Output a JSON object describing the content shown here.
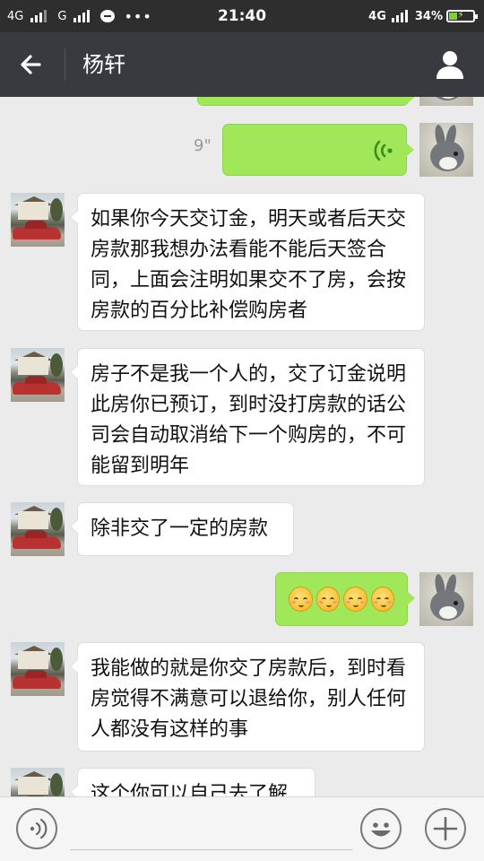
{
  "status_bar": {
    "left_network_1": "4G",
    "left_network_2": "G",
    "time": "21:40",
    "right_network": "4G",
    "battery_percent": "34%",
    "battery_level": 0.34
  },
  "header": {
    "title": "杨轩",
    "back_icon": "arrow-left-icon",
    "profile_icon": "person-icon"
  },
  "messages": [
    {
      "side": "right",
      "type": "text",
      "text": ""
    },
    {
      "side": "right",
      "type": "voice",
      "duration": "9\""
    },
    {
      "side": "left",
      "type": "text",
      "text": "如果你今天交订金，明天或者后天交房款那我想办法看能不能后天签合同，上面会注明如果交不了房，会按房款的百分比补偿购房者"
    },
    {
      "side": "left",
      "type": "text",
      "text": "房子不是我一个人的，交了订金说明此房你已预订，到时没打房款的话公司会自动取消给下一个购房的，不可能留到明年"
    },
    {
      "side": "left",
      "type": "text",
      "text": "除非交了一定的房款"
    },
    {
      "side": "right",
      "type": "emoji",
      "count": 4,
      "icon": "blushing-face-icon"
    },
    {
      "side": "left",
      "type": "text",
      "text": "我能做的就是你交了房款后，到时看房觉得不满意可以退给你，别人任何人都没有这样的事"
    },
    {
      "side": "left",
      "type": "text",
      "text": "这个你可以自己去了解"
    }
  ],
  "input_bar": {
    "voice_icon": "voice-wave-icon",
    "emoji_icon": "smiley-icon",
    "plus_icon": "plus-icon",
    "placeholder": ""
  },
  "colors": {
    "titlebar": "#393a3f",
    "statusbar": "#2e2e2e",
    "chat_bg": "#ebebeb",
    "sent_bubble": "#a0e75a",
    "received_bubble": "#ffffff"
  }
}
